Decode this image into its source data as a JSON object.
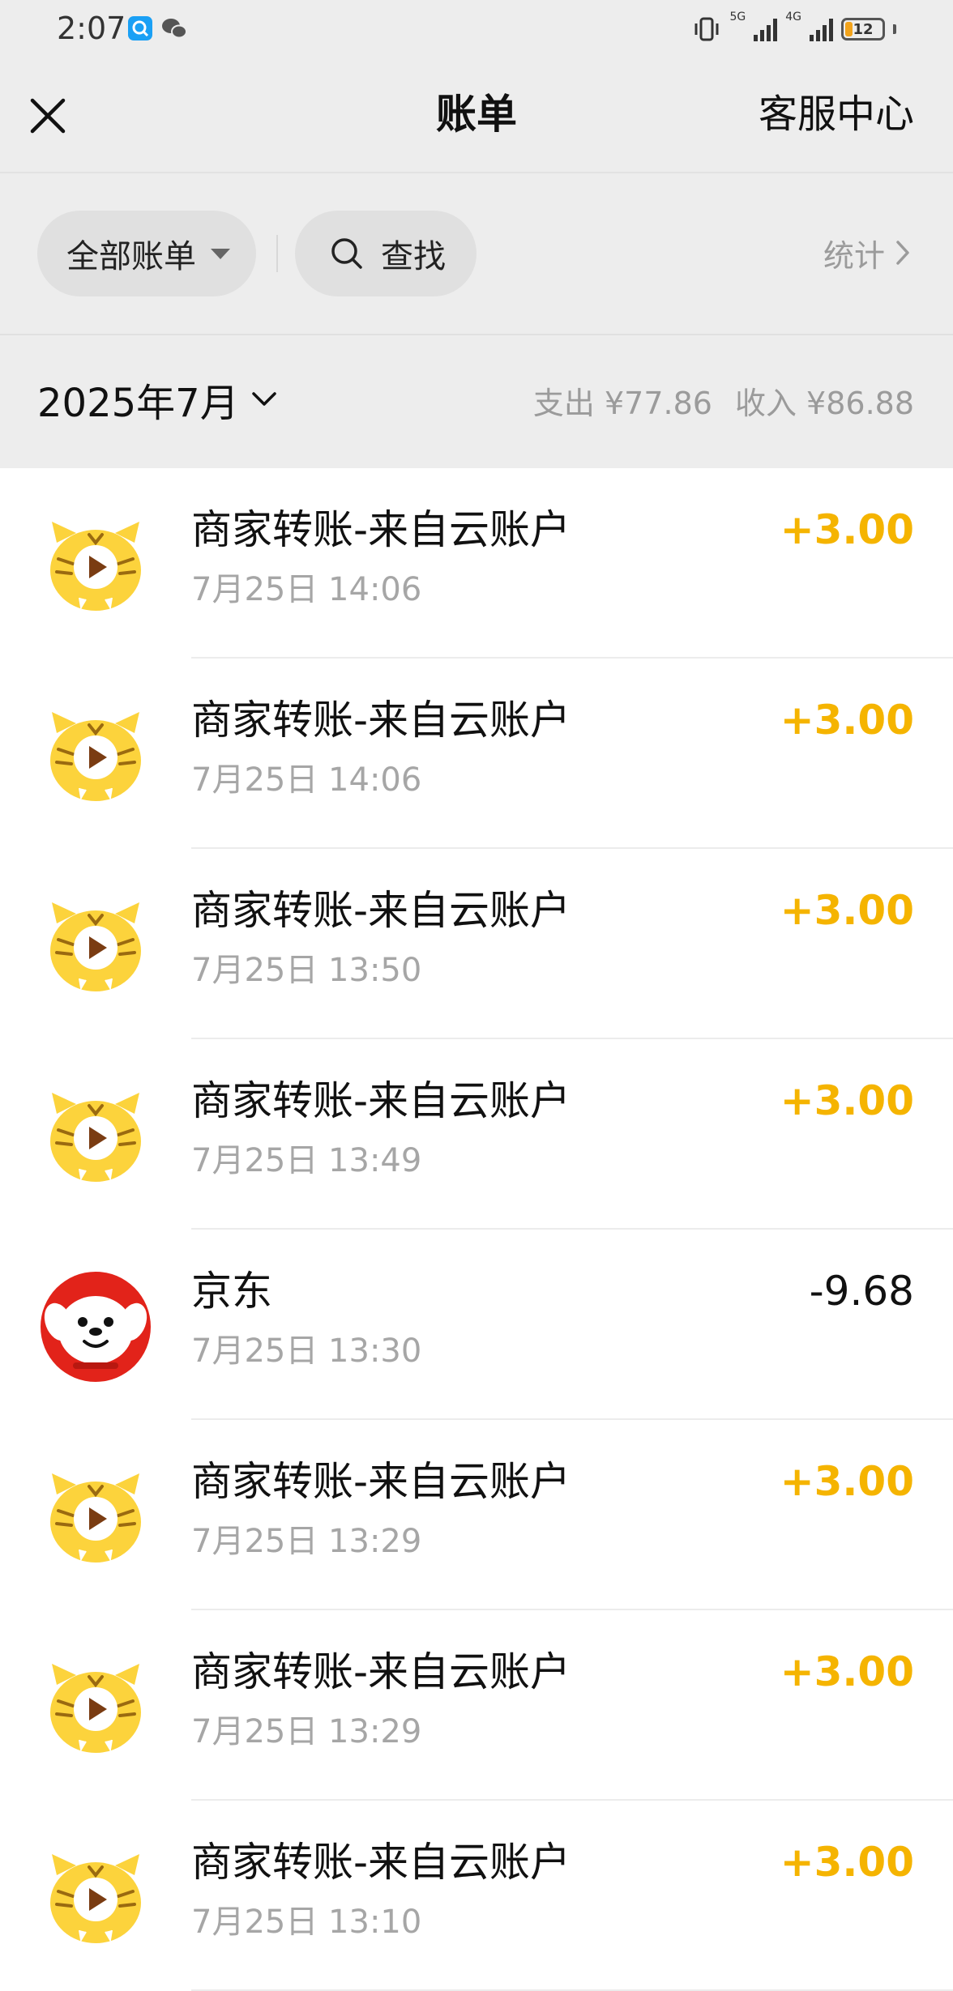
{
  "status_bar": {
    "time": "2:07",
    "network_5g": "5G",
    "network_4g": "4G",
    "battery": "12"
  },
  "nav": {
    "title": "账单",
    "service": "客服中心"
  },
  "filters": {
    "all_bills": "全部账单",
    "search": "查找",
    "stats": "统计"
  },
  "month": {
    "label": "2025年7月",
    "expense": "支出 ¥77.86",
    "income": "收入 ¥86.88"
  },
  "colors": {
    "income": "#f5b400",
    "jd_red": "#e2231a",
    "tiger_yellow": "#fcd33c"
  },
  "transactions": [
    {
      "name": "商家转账-来自云账户",
      "date": "7月25日 14:06",
      "amount": "+3.00",
      "type": "income",
      "icon": "tiger-icon"
    },
    {
      "name": "商家转账-来自云账户",
      "date": "7月25日 14:06",
      "amount": "+3.00",
      "type": "income",
      "icon": "tiger-icon"
    },
    {
      "name": "商家转账-来自云账户",
      "date": "7月25日 13:50",
      "amount": "+3.00",
      "type": "income",
      "icon": "tiger-icon"
    },
    {
      "name": "商家转账-来自云账户",
      "date": "7月25日 13:49",
      "amount": "+3.00",
      "type": "income",
      "icon": "tiger-icon"
    },
    {
      "name": "京东",
      "date": "7月25日 13:30",
      "amount": "-9.68",
      "type": "expense",
      "icon": "jd-dog-icon"
    },
    {
      "name": "商家转账-来自云账户",
      "date": "7月25日 13:29",
      "amount": "+3.00",
      "type": "income",
      "icon": "tiger-icon"
    },
    {
      "name": "商家转账-来自云账户",
      "date": "7月25日 13:29",
      "amount": "+3.00",
      "type": "income",
      "icon": "tiger-icon"
    },
    {
      "name": "商家转账-来自云账户",
      "date": "7月25日 13:10",
      "amount": "+3.00",
      "type": "income",
      "icon": "tiger-icon"
    }
  ]
}
